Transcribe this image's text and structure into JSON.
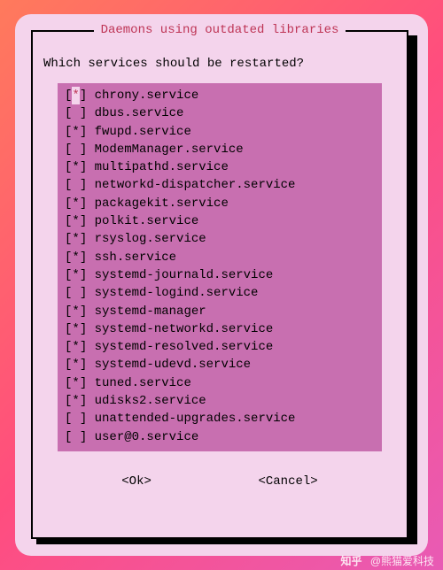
{
  "dialog": {
    "title": "Daemons using outdated libraries",
    "prompt": "Which services should be restarted?",
    "services": [
      {
        "checked": true,
        "name": "chrony.service"
      },
      {
        "checked": false,
        "name": "dbus.service"
      },
      {
        "checked": true,
        "name": "fwupd.service"
      },
      {
        "checked": false,
        "name": "ModemManager.service"
      },
      {
        "checked": true,
        "name": "multipathd.service"
      },
      {
        "checked": false,
        "name": "networkd-dispatcher.service"
      },
      {
        "checked": true,
        "name": "packagekit.service"
      },
      {
        "checked": true,
        "name": "polkit.service"
      },
      {
        "checked": true,
        "name": "rsyslog.service"
      },
      {
        "checked": true,
        "name": "ssh.service"
      },
      {
        "checked": true,
        "name": "systemd-journald.service"
      },
      {
        "checked": false,
        "name": "systemd-logind.service"
      },
      {
        "checked": true,
        "name": "systemd-manager"
      },
      {
        "checked": true,
        "name": "systemd-networkd.service"
      },
      {
        "checked": true,
        "name": "systemd-resolved.service"
      },
      {
        "checked": true,
        "name": "systemd-udevd.service"
      },
      {
        "checked": true,
        "name": "tuned.service"
      },
      {
        "checked": true,
        "name": "udisks2.service"
      },
      {
        "checked": false,
        "name": "unattended-upgrades.service"
      },
      {
        "checked": false,
        "name": "user@0.service"
      }
    ],
    "ok_label": "<Ok>",
    "cancel_label": "<Cancel>"
  },
  "watermark": {
    "brand": "知乎",
    "author": "@熊猫爱科技"
  }
}
